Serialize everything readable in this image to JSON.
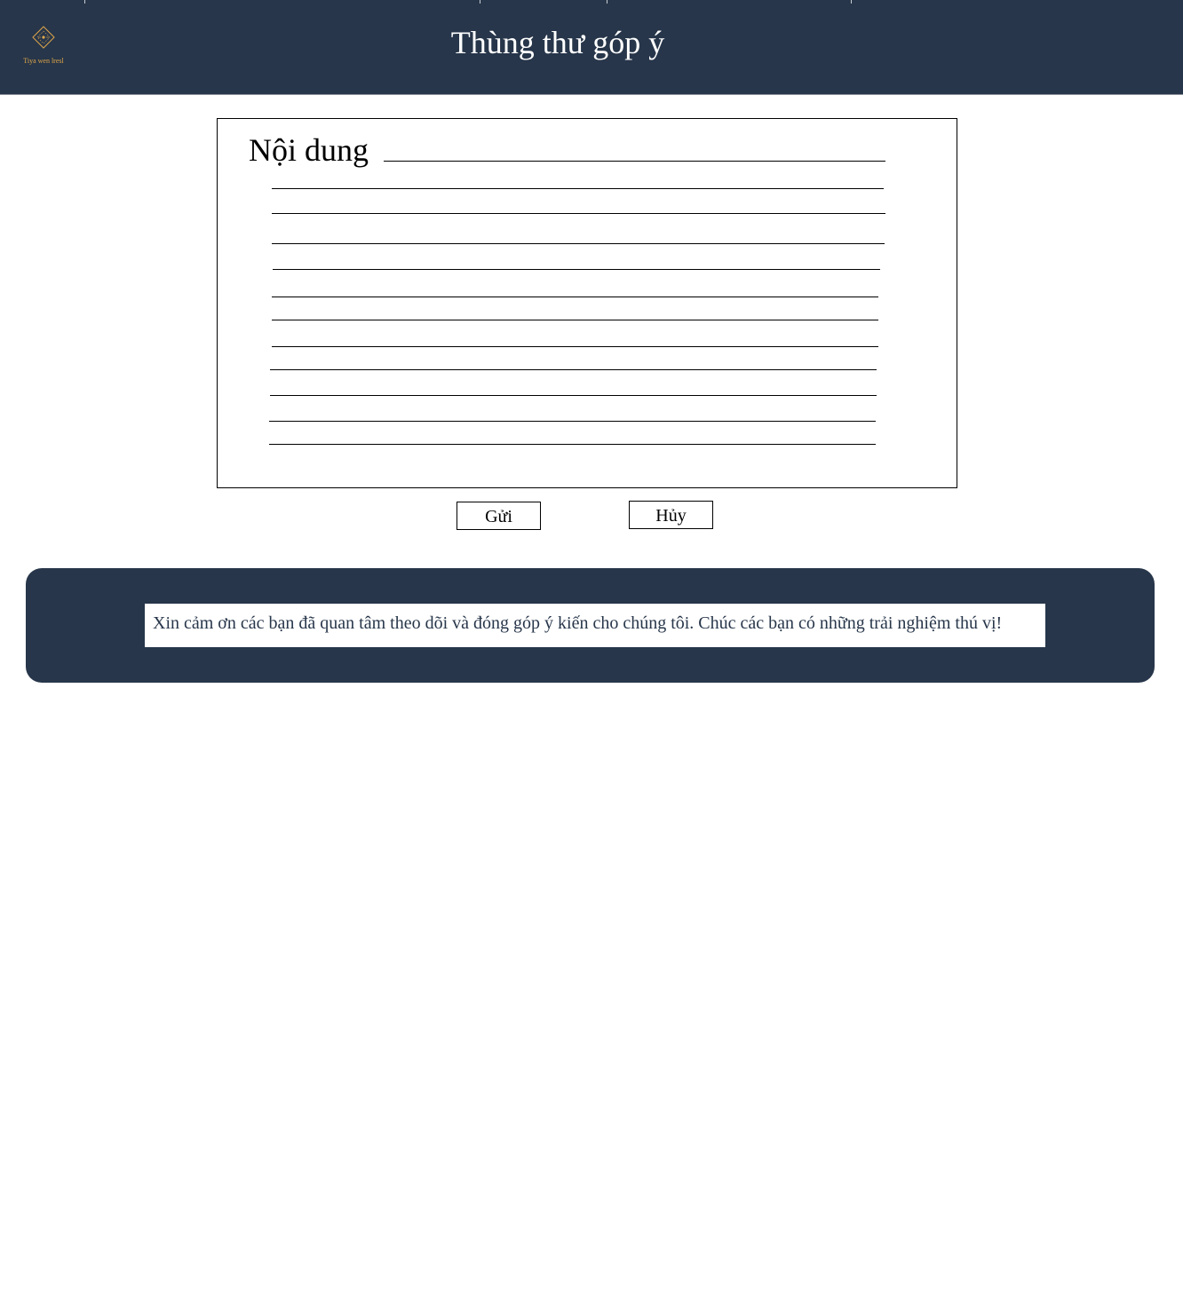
{
  "header": {
    "logo_text": "Tiya wen lresl",
    "title": "Thùng thư góp ý"
  },
  "form": {
    "content_label": "Nội dung",
    "submit_label": "Gửi",
    "cancel_label": "Hủy"
  },
  "footer": {
    "message": "Xin cảm ơn các bạn đã quan tâm theo dõi và đóng góp ý kiến cho chúng tôi. Chúc các bạn có những trải nghiệm thú vị!"
  },
  "colors": {
    "header_bg": "#27364a",
    "logo_gold": "#e0a64a"
  }
}
